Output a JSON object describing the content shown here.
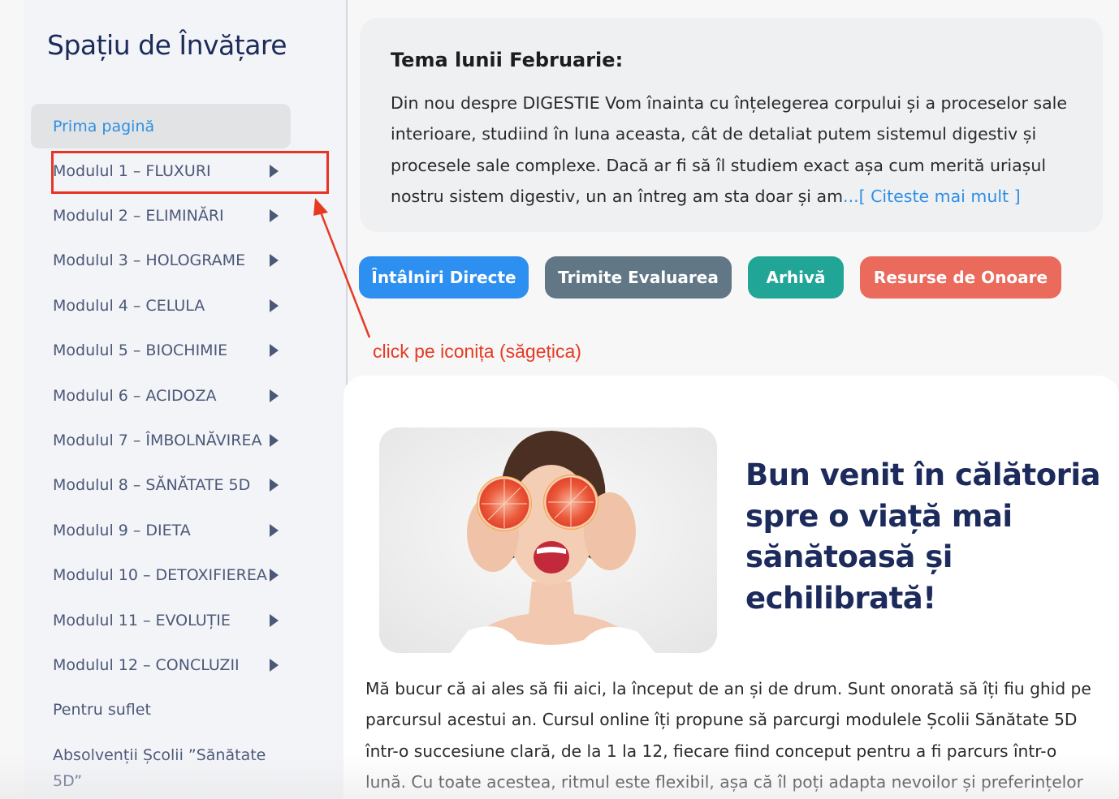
{
  "sidebar": {
    "title": "Spațiu de Învățare",
    "items": [
      {
        "label": "Prima pagină"
      },
      {
        "label": "Modulul 1 – FLUXURI"
      },
      {
        "label": "Modulul 2 – ELIMINĂRI"
      },
      {
        "label": "Modulul 3 – HOLOGRAME"
      },
      {
        "label": "Modulul 4 – CELULA"
      },
      {
        "label": "Modulul 5 – BIOCHIMIE"
      },
      {
        "label": "Modulul 6 – ACIDOZA"
      },
      {
        "label": "Modulul 7 – ÎMBOLNĂVIREA"
      },
      {
        "label": "Modulul 8 – SĂNĂTATE 5D"
      },
      {
        "label": "Modulul 9 – DIETA"
      },
      {
        "label": "Modulul 10 – DETOXIFIEREA"
      },
      {
        "label": "Modulul 11 – EVOLUȚIE"
      },
      {
        "label": "Modulul 12 – CONCLUZII"
      },
      {
        "label": "Pentru suflet"
      },
      {
        "label": "Absolvenții Școlii ”Sănătate 5D”"
      }
    ]
  },
  "annotation": {
    "text": "click pe iconița (săgețica)",
    "color": "#e63a22"
  },
  "theme": {
    "title": "Tema lunii Februarie:",
    "text": "Din nou despre DIGESTIE Vom înainta cu înțelegerea corpului și a proceselor sale interioare, studiind în luna aceasta, cât de detaliat putem sistemul digestiv și procesele sale complexe. Dacă ar fi să îl studiem exact așa cum merită uriașul nostru sistem digestiv, un an întreg am sta doar și am",
    "read_more": "...[ Citeste mai mult ]"
  },
  "buttons": {
    "meetings": "Întâlniri Directe",
    "evaluation": "Trimite Evaluarea",
    "archive": "Arhivă",
    "resources": "Resurse de Onoare"
  },
  "colors": {
    "accent_blue": "#2d8ff0",
    "slate": "#617786",
    "teal": "#21a596",
    "coral": "#ea6a5c",
    "heading_navy": "#1c2a5c"
  },
  "main": {
    "heading": "Bun venit în călătoria spre o viață mai sănătoasă și echilibrată!",
    "intro": "Mă bucur că ai ales să fii aici, la început de an și de drum. Sunt onorată să îți fiu ghid pe parcursul acestui an. Cursul online îți propune să parcurgi modulele Școlii Sănătate 5D într-o succesiune clară, de la 1 la 12, fiecare fiind conceput pentru a fi parcurs într-o lună. Cu toate acestea, ritmul este flexibil, așa că îl poți adapta nevoilor și preferințelor"
  }
}
